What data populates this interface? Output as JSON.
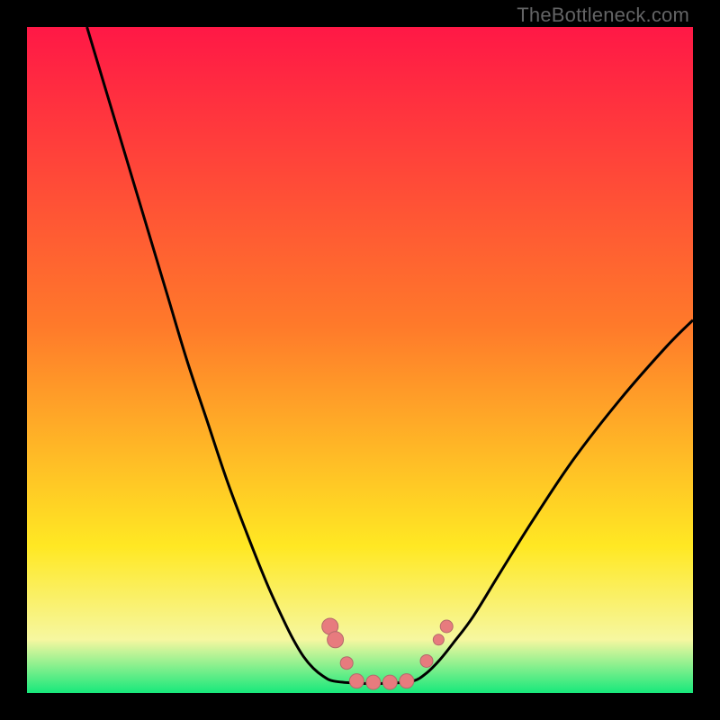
{
  "watermark": {
    "text": "TheBottleneck.com"
  },
  "colors": {
    "top": "#ff1846",
    "mid1": "#ff7a2a",
    "mid2": "#ffe823",
    "bottom": "#17e87b",
    "curve": "#000000",
    "marker_fill": "#e77b7e",
    "marker_stroke": "#b36a6b"
  },
  "chart_data": {
    "type": "line",
    "title": "",
    "xlabel": "",
    "ylabel": "",
    "xlim": [
      0,
      100
    ],
    "ylim": [
      0,
      100
    ],
    "series": [
      {
        "name": "curve-left",
        "x": [
          9,
          12,
          15,
          18,
          21,
          24,
          27,
          30,
          33,
          36,
          38.5,
          40,
          41.5,
          43,
          44.5,
          46
        ],
        "values": [
          100,
          90,
          80,
          70,
          60,
          50,
          41,
          32,
          24,
          16.5,
          11,
          8,
          5.5,
          3.7,
          2.5,
          1.8
        ]
      },
      {
        "name": "curve-floor",
        "x": [
          46,
          49,
          52,
          55,
          58
        ],
        "values": [
          1.8,
          1.5,
          1.4,
          1.5,
          1.8
        ]
      },
      {
        "name": "curve-right",
        "x": [
          58,
          60,
          62,
          64,
          67,
          71,
          76,
          82,
          89,
          96,
          100
        ],
        "values": [
          1.8,
          3.0,
          5.0,
          7.5,
          11.5,
          18,
          26,
          35,
          44,
          52,
          56
        ]
      }
    ],
    "markers": [
      {
        "name": "m-left-1",
        "x": 45.5,
        "y": 10.0,
        "r": 9
      },
      {
        "name": "m-left-2",
        "x": 46.3,
        "y": 8.0,
        "r": 9
      },
      {
        "name": "m-left-3",
        "x": 48.0,
        "y": 4.5,
        "r": 7
      },
      {
        "name": "m-floor-1",
        "x": 49.5,
        "y": 1.8,
        "r": 8
      },
      {
        "name": "m-floor-2",
        "x": 52.0,
        "y": 1.6,
        "r": 8
      },
      {
        "name": "m-floor-3",
        "x": 54.5,
        "y": 1.6,
        "r": 8
      },
      {
        "name": "m-floor-4",
        "x": 57.0,
        "y": 1.8,
        "r": 8
      },
      {
        "name": "m-right-1",
        "x": 60.0,
        "y": 4.8,
        "r": 7
      },
      {
        "name": "m-right-2",
        "x": 61.8,
        "y": 8.0,
        "r": 6
      },
      {
        "name": "m-right-3",
        "x": 63.0,
        "y": 10.0,
        "r": 7
      }
    ]
  }
}
